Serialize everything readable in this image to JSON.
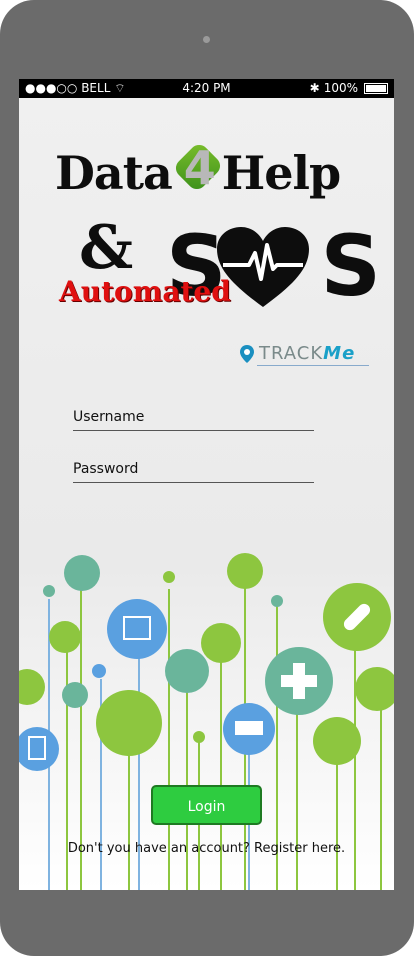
{
  "status": {
    "carrier": "BELL",
    "signal_dots": "●●●○○",
    "time": "4:20 PM",
    "battery": "100%"
  },
  "logo": {
    "part1": "Data",
    "part2": "4",
    "part3": "Help",
    "amp": "&",
    "automated": "Automated",
    "sos_s1": "S",
    "sos_s2": "S",
    "trackme_track": "TRACK",
    "trackme_me": "Me"
  },
  "form": {
    "username_placeholder": "Username",
    "password_placeholder": "Password"
  },
  "login_label": "Login",
  "register_text": "Don't you have an account? Register here.",
  "colors": {
    "accent": "#2ecc40",
    "red": "#e01010",
    "trackme": "#1a8fc0"
  }
}
